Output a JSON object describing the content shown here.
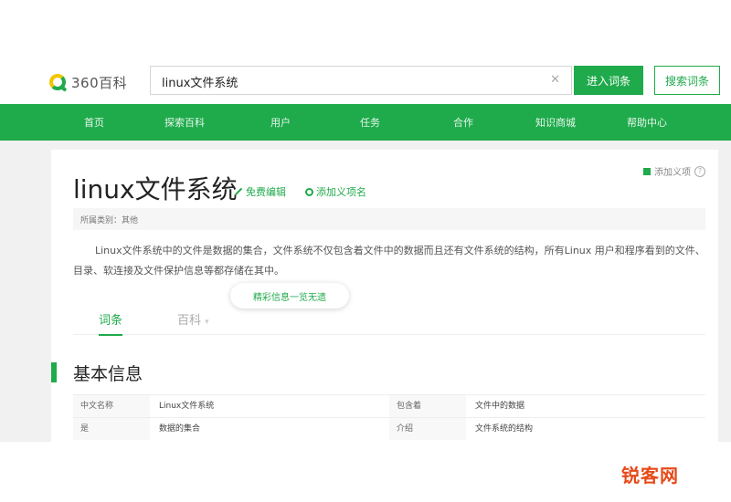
{
  "logo": {
    "text": "360百科"
  },
  "search": {
    "value": "linux文件系统",
    "enter_label": "进入词条",
    "search_label": "搜索词条"
  },
  "nav": {
    "items": [
      "首页",
      "探索百科",
      "用户",
      "任务",
      "合作",
      "知识商城",
      "帮助中心"
    ]
  },
  "entry": {
    "title": "linux文件系统",
    "edit_label": "免费编辑",
    "add_label": "添加义项名",
    "fav_label": "添加义项",
    "category": "所属类别：其他",
    "summary": "Linux文件系统中的文件是数据的集合，文件系统不仅包含着文件中的数据而且还有文件系统的结构，所有Linux 用户和程序看到的文件、目录、软连接及文件保护信息等都存储在其中。",
    "tip": "精彩信息一览无遗"
  },
  "tabs": [
    {
      "label": "词条"
    },
    {
      "label": "百科"
    }
  ],
  "basic_info": {
    "title": "基本信息",
    "rows": [
      {
        "l1": "中文名称",
        "v1": "Linux文件系统",
        "l2": "包含着",
        "v2": "文件中的数据"
      },
      {
        "l1": "是",
        "v1": "数据的集合",
        "l2": "介绍",
        "v2": "文件系统的结构"
      }
    ]
  },
  "watermark": "锐客网",
  "colors": {
    "accent": "#1faa4b",
    "watermark": "#e64a19"
  }
}
